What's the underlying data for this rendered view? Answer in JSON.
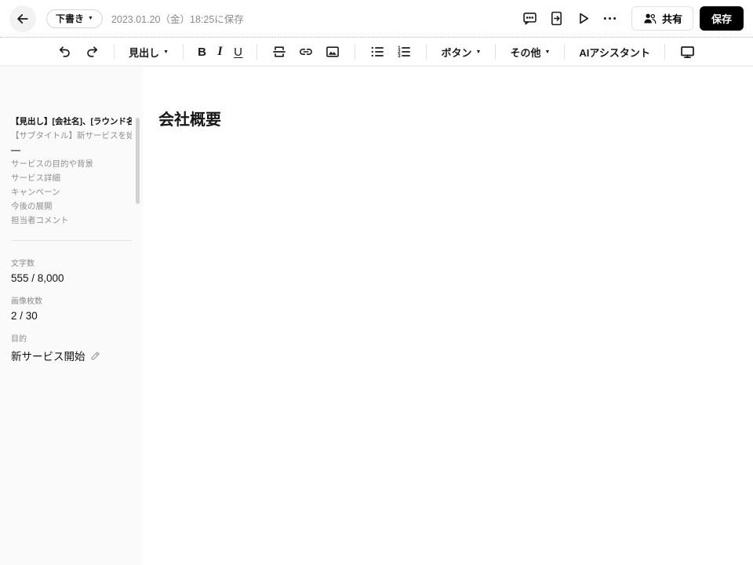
{
  "glyphs": {
    "caret_down": "▼"
  },
  "colors": {
    "save_button_bg": "#000000",
    "text_primary": "#1a1a1a",
    "text_muted": "#8a8a8a",
    "sidebar_bg": "#fafafa",
    "border_dotted": "#bdbdbd"
  },
  "topbar": {
    "back_icon": "arrow-left-icon",
    "status_dropdown_label": "下書き",
    "saved_at": "2023.01.20（金）18:25に保存",
    "icons": [
      "comment-icon",
      "export-document-icon",
      "play-icon",
      "more-icon"
    ],
    "share_label": "共有",
    "save_label": "保存"
  },
  "toolbar": {
    "heading_label": "見出し",
    "bold_label": "B",
    "italic_label": "I",
    "underline_label": "U",
    "button_label": "ボタン",
    "other_label": "その他",
    "ai_label": "AIアシスタント",
    "icons": [
      "undo-icon",
      "redo-icon",
      "divider-block-icon",
      "link-icon",
      "image-icon",
      "bullet-list-icon",
      "numbered-list-icon",
      "monitor-icon"
    ]
  },
  "sidebar": {
    "outline": [
      {
        "label": "【見出し】[会社名]、[ラウンド名]にお...",
        "style": "heading"
      },
      {
        "label": "【サブタイトル】新サービスを始動…",
        "style": "muted"
      },
      {
        "label": "—",
        "style": "dash"
      },
      {
        "label": "サービスの目的や背景",
        "style": "muted"
      },
      {
        "label": "サービス詳細",
        "style": "muted"
      },
      {
        "label": "キャンペーン",
        "style": "muted"
      },
      {
        "label": "今後の展開",
        "style": "muted"
      },
      {
        "label": "担当者コメント",
        "style": "muted"
      }
    ],
    "stats": [
      {
        "label": "文字数",
        "value": "555 / 8,000"
      },
      {
        "label": "画像枚数",
        "value": "2 / 30"
      },
      {
        "label": "目的",
        "value": "新サービス開始",
        "editable": true
      }
    ]
  },
  "editor": {
    "heading": "会社概要"
  }
}
